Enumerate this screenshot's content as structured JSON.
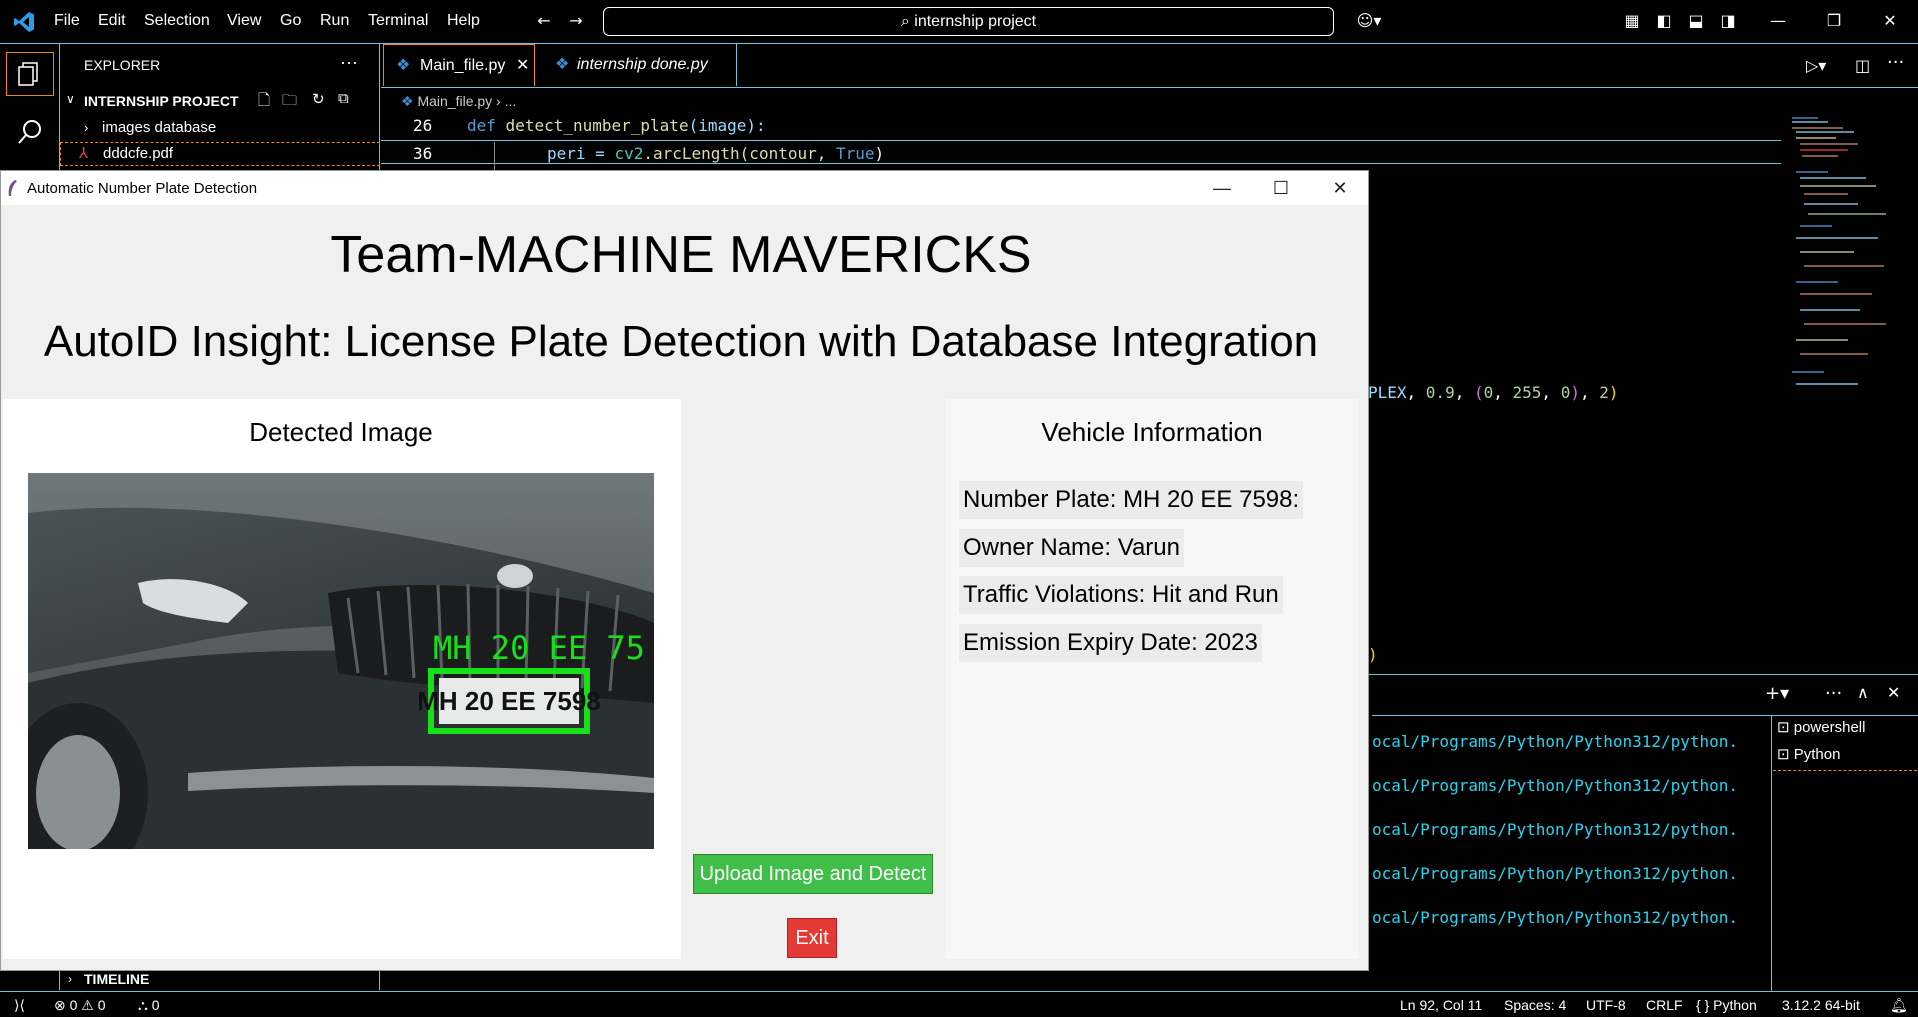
{
  "menu": [
    "File",
    "Edit",
    "Selection",
    "View",
    "Go",
    "Run",
    "Terminal",
    "Help"
  ],
  "search": {
    "text": "internship project"
  },
  "explorer": {
    "header": "EXPLORER",
    "project": "INTERNSHIP PROJECT",
    "items": [
      "images database",
      "dddcfe.pdf"
    ],
    "timeline": "TIMELINE"
  },
  "tabs": [
    {
      "label": "Main_file.py"
    },
    {
      "label": "internship done.py"
    }
  ],
  "breadcrumb": {
    "file": "Main_file.py",
    "rest": "..."
  },
  "code": {
    "line1": {
      "num": "26",
      "kw": "def",
      "fn": "detect_number_plate",
      "args": "(image):"
    },
    "line2": {
      "num": "36",
      "indent": "peri = ",
      "mod": "cv2",
      "call": ".arcLength(contour, ",
      "kw": "True",
      ")": ")"
    },
    "line3": "PLEX, 0.9, (0, 255, 0), 2)",
    "line4": ")"
  },
  "terminal": {
    "lines": [
      "ocal/Programs/Python/Python312/python.",
      "ocal/Programs/Python/Python312/python.",
      "ocal/Programs/Python/Python312/python.",
      "ocal/Programs/Python/Python312/python.",
      "ocal/Programs/Python/Python312/python."
    ],
    "sessions": [
      "powershell",
      "Python"
    ]
  },
  "status": {
    "errors": "0",
    "warnings": "0",
    "ports": "0",
    "position": "Ln 92, Col 11",
    "spaces": "Spaces: 4",
    "encoding": "UTF-8",
    "eol": "CRLF",
    "language": "Python",
    "interpreter": "3.12.2 64-bit"
  },
  "app": {
    "window_title": "Automatic Number Plate Detection",
    "team": "Team-MACHINE MAVERICKS",
    "subtitle": "AutoID Insight: License Plate Detection with Database Integration",
    "detected_heading": "Detected Image",
    "overlay_text": "MH 20 EE 75",
    "plate_text": "MH 20 EE 7598",
    "vehicle_heading": "Vehicle Information",
    "info": [
      "Number Plate: MH 20 EE 7598:",
      "Owner Name: Varun",
      "Traffic Violations: Hit and Run",
      "Emission Expiry Date: 2023"
    ],
    "upload_label": "Upload Image and Detect",
    "exit_label": "Exit"
  }
}
